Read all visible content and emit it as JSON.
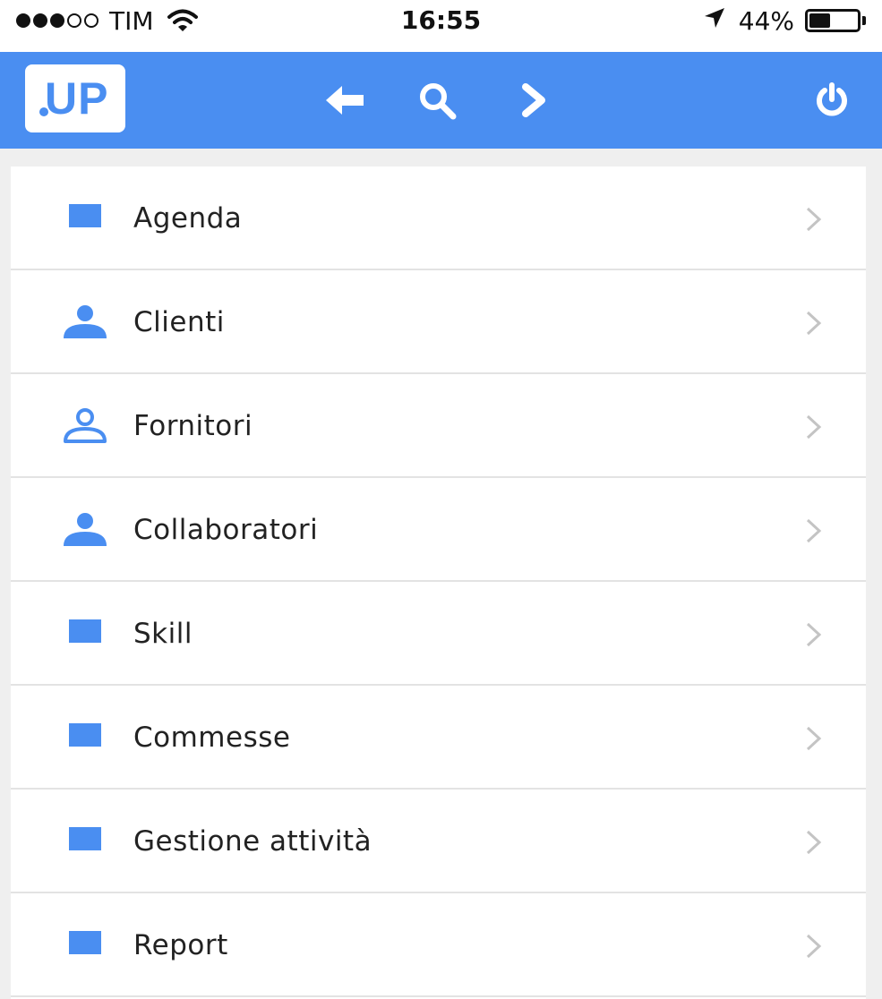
{
  "status_bar": {
    "carrier": "TIM",
    "time": "16:55",
    "battery_percent": "44%",
    "battery_level": 0.44,
    "signal_bars_filled": 3,
    "signal_bars_total": 5
  },
  "app_bar": {
    "logo_text": "UP",
    "icons": {
      "back": "arrow-left-icon",
      "search": "search-icon",
      "forward": "chevron-right-icon",
      "power": "power-icon"
    }
  },
  "menu": {
    "items": [
      {
        "label": "Agenda",
        "icon": "square-icon"
      },
      {
        "label": "Clienti",
        "icon": "person-icon"
      },
      {
        "label": "Fornitori",
        "icon": "person-outline-icon"
      },
      {
        "label": "Collaboratori",
        "icon": "person-icon"
      },
      {
        "label": "Skill",
        "icon": "square-icon"
      },
      {
        "label": "Commesse",
        "icon": "square-icon"
      },
      {
        "label": "Gestione attività",
        "icon": "square-icon"
      },
      {
        "label": "Report",
        "icon": "square-icon"
      }
    ]
  },
  "colors": {
    "accent": "#4a8ef1",
    "app_bar_background": "#4a8ef1",
    "list_background": "#ffffff",
    "page_background": "#efefef",
    "divider": "#e3e3e3",
    "chevron": "#c4c4c4"
  }
}
